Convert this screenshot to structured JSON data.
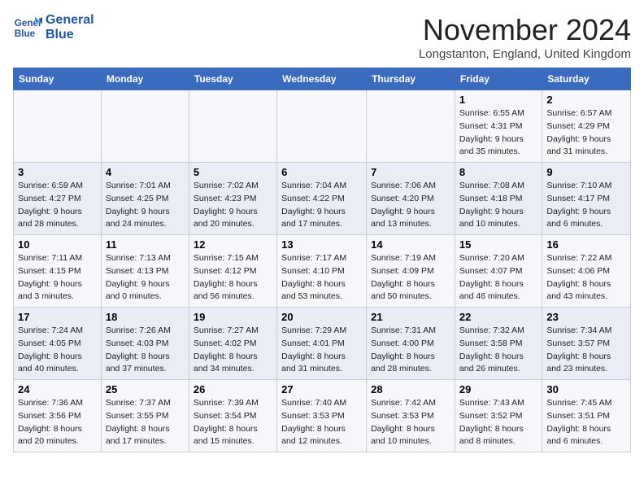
{
  "logo": {
    "line1": "General",
    "line2": "Blue"
  },
  "title": "November 2024",
  "location": "Longstanton, England, United Kingdom",
  "days_of_week": [
    "Sunday",
    "Monday",
    "Tuesday",
    "Wednesday",
    "Thursday",
    "Friday",
    "Saturday"
  ],
  "weeks": [
    [
      {
        "day": "",
        "info": ""
      },
      {
        "day": "",
        "info": ""
      },
      {
        "day": "",
        "info": ""
      },
      {
        "day": "",
        "info": ""
      },
      {
        "day": "",
        "info": ""
      },
      {
        "day": "1",
        "info": "Sunrise: 6:55 AM\nSunset: 4:31 PM\nDaylight: 9 hours and 35 minutes."
      },
      {
        "day": "2",
        "info": "Sunrise: 6:57 AM\nSunset: 4:29 PM\nDaylight: 9 hours and 31 minutes."
      }
    ],
    [
      {
        "day": "3",
        "info": "Sunrise: 6:59 AM\nSunset: 4:27 PM\nDaylight: 9 hours and 28 minutes."
      },
      {
        "day": "4",
        "info": "Sunrise: 7:01 AM\nSunset: 4:25 PM\nDaylight: 9 hours and 24 minutes."
      },
      {
        "day": "5",
        "info": "Sunrise: 7:02 AM\nSunset: 4:23 PM\nDaylight: 9 hours and 20 minutes."
      },
      {
        "day": "6",
        "info": "Sunrise: 7:04 AM\nSunset: 4:22 PM\nDaylight: 9 hours and 17 minutes."
      },
      {
        "day": "7",
        "info": "Sunrise: 7:06 AM\nSunset: 4:20 PM\nDaylight: 9 hours and 13 minutes."
      },
      {
        "day": "8",
        "info": "Sunrise: 7:08 AM\nSunset: 4:18 PM\nDaylight: 9 hours and 10 minutes."
      },
      {
        "day": "9",
        "info": "Sunrise: 7:10 AM\nSunset: 4:17 PM\nDaylight: 9 hours and 6 minutes."
      }
    ],
    [
      {
        "day": "10",
        "info": "Sunrise: 7:11 AM\nSunset: 4:15 PM\nDaylight: 9 hours and 3 minutes."
      },
      {
        "day": "11",
        "info": "Sunrise: 7:13 AM\nSunset: 4:13 PM\nDaylight: 9 hours and 0 minutes."
      },
      {
        "day": "12",
        "info": "Sunrise: 7:15 AM\nSunset: 4:12 PM\nDaylight: 8 hours and 56 minutes."
      },
      {
        "day": "13",
        "info": "Sunrise: 7:17 AM\nSunset: 4:10 PM\nDaylight: 8 hours and 53 minutes."
      },
      {
        "day": "14",
        "info": "Sunrise: 7:19 AM\nSunset: 4:09 PM\nDaylight: 8 hours and 50 minutes."
      },
      {
        "day": "15",
        "info": "Sunrise: 7:20 AM\nSunset: 4:07 PM\nDaylight: 8 hours and 46 minutes."
      },
      {
        "day": "16",
        "info": "Sunrise: 7:22 AM\nSunset: 4:06 PM\nDaylight: 8 hours and 43 minutes."
      }
    ],
    [
      {
        "day": "17",
        "info": "Sunrise: 7:24 AM\nSunset: 4:05 PM\nDaylight: 8 hours and 40 minutes."
      },
      {
        "day": "18",
        "info": "Sunrise: 7:26 AM\nSunset: 4:03 PM\nDaylight: 8 hours and 37 minutes."
      },
      {
        "day": "19",
        "info": "Sunrise: 7:27 AM\nSunset: 4:02 PM\nDaylight: 8 hours and 34 minutes."
      },
      {
        "day": "20",
        "info": "Sunrise: 7:29 AM\nSunset: 4:01 PM\nDaylight: 8 hours and 31 minutes."
      },
      {
        "day": "21",
        "info": "Sunrise: 7:31 AM\nSunset: 4:00 PM\nDaylight: 8 hours and 28 minutes."
      },
      {
        "day": "22",
        "info": "Sunrise: 7:32 AM\nSunset: 3:58 PM\nDaylight: 8 hours and 26 minutes."
      },
      {
        "day": "23",
        "info": "Sunrise: 7:34 AM\nSunset: 3:57 PM\nDaylight: 8 hours and 23 minutes."
      }
    ],
    [
      {
        "day": "24",
        "info": "Sunrise: 7:36 AM\nSunset: 3:56 PM\nDaylight: 8 hours and 20 minutes."
      },
      {
        "day": "25",
        "info": "Sunrise: 7:37 AM\nSunset: 3:55 PM\nDaylight: 8 hours and 17 minutes."
      },
      {
        "day": "26",
        "info": "Sunrise: 7:39 AM\nSunset: 3:54 PM\nDaylight: 8 hours and 15 minutes."
      },
      {
        "day": "27",
        "info": "Sunrise: 7:40 AM\nSunset: 3:53 PM\nDaylight: 8 hours and 12 minutes."
      },
      {
        "day": "28",
        "info": "Sunrise: 7:42 AM\nSunset: 3:53 PM\nDaylight: 8 hours and 10 minutes."
      },
      {
        "day": "29",
        "info": "Sunrise: 7:43 AM\nSunset: 3:52 PM\nDaylight: 8 hours and 8 minutes."
      },
      {
        "day": "30",
        "info": "Sunrise: 7:45 AM\nSunset: 3:51 PM\nDaylight: 8 hours and 6 minutes."
      }
    ]
  ]
}
